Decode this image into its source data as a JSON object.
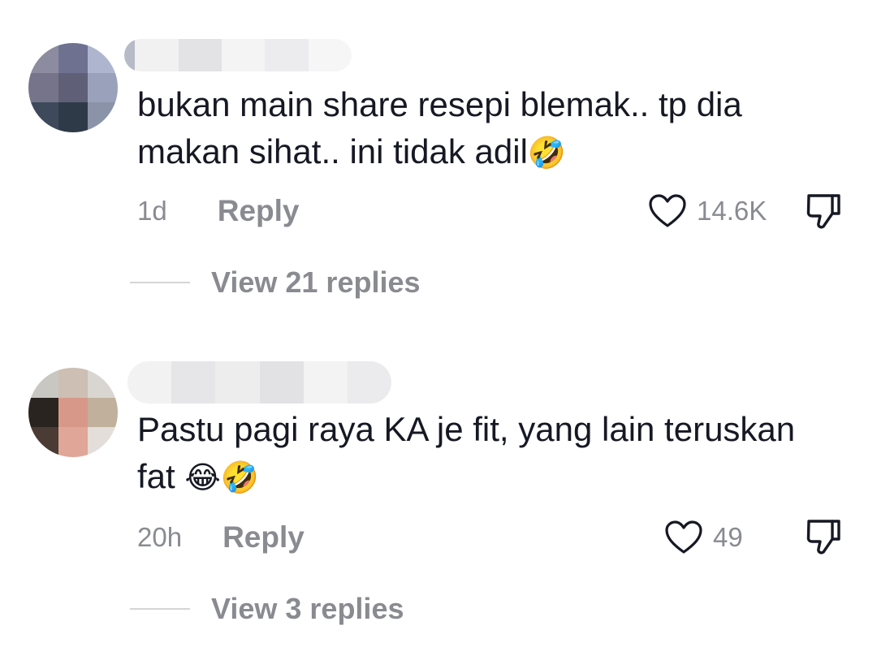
{
  "comments": [
    {
      "text": "bukan main share resepi blemak.. tp dia makan sihat.. ini tidak adil",
      "emojis": "🤣",
      "time": "1d",
      "reply_label": "Reply",
      "like_count": "14.6K",
      "view_replies_label": "View 21 replies",
      "avatar_icon": "blurred-avatar",
      "colors": {
        "avatar_tones": [
          "#8d8b9f",
          "#6f7190",
          "#aeb6cf",
          "#76748a",
          "#5f6078",
          "#9aa2bb",
          "#3e4a5c",
          "#2f3a48",
          "#8b93a8"
        ]
      }
    },
    {
      "text": "Pastu pagi raya KA je fit, yang lain teruskan fat ",
      "emojis": "😂🤣",
      "time": "20h",
      "reply_label": "Reply",
      "like_count": "49",
      "view_replies_label": "View 3 replies",
      "avatar_icon": "blurred-avatar",
      "colors": {
        "avatar_tones": [
          "#c9c7c2",
          "#cdbfb4",
          "#d9d6d2",
          "#2a2420",
          "#d7988a",
          "#c1b09c",
          "#4a3b34",
          "#e0a697",
          "#e3ded9"
        ]
      }
    }
  ],
  "icons": {
    "like": "heart-outline-icon",
    "dislike": "thumbs-down-icon"
  },
  "colors": {
    "text": "#161823",
    "secondary": "#8a8b91",
    "background": "#ffffff"
  }
}
